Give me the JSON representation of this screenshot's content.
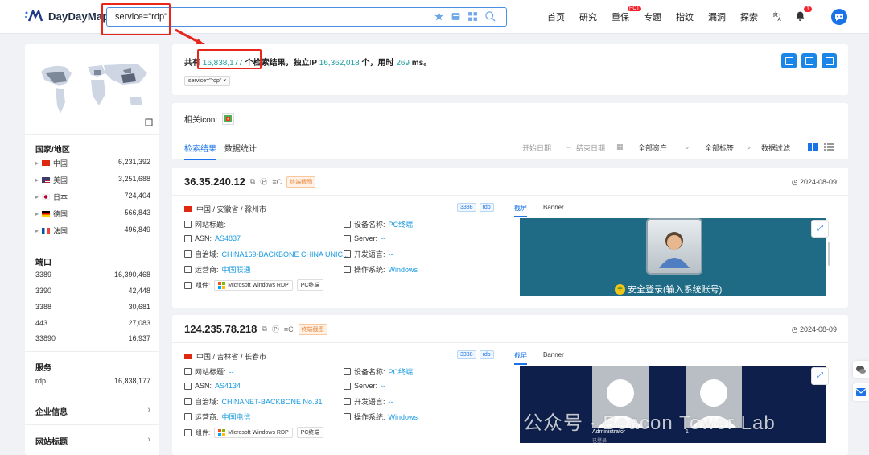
{
  "app": {
    "name": "DayDayMap"
  },
  "search": {
    "query": "service=\"rdp\""
  },
  "nav": [
    {
      "label": "首页"
    },
    {
      "label": "研究"
    },
    {
      "label": "重保",
      "badge": "HOT"
    },
    {
      "label": "专题"
    },
    {
      "label": "指纹"
    },
    {
      "label": "漏洞"
    },
    {
      "label": "探索"
    },
    {
      "label": "···"
    }
  ],
  "notifications": {
    "count": "1"
  },
  "summary": {
    "prefix": "共有",
    "total": "16,838,177",
    "mid1": "个检索结果，独立IP",
    "unique_ip": "16,362,018",
    "mid2": "个，用时",
    "time": "269",
    "suffix": "ms。",
    "chip": "service=\"rdp\""
  },
  "country": {
    "title": "国家/地区",
    "items": [
      {
        "flag": "cn",
        "name": "中国",
        "count": "6,231,392"
      },
      {
        "flag": "us",
        "name": "美国",
        "count": "3,251,688"
      },
      {
        "flag": "jp",
        "name": "日本",
        "count": "724,404"
      },
      {
        "flag": "de",
        "name": "德国",
        "count": "566,843"
      },
      {
        "flag": "fr",
        "name": "法国",
        "count": "496,849"
      }
    ]
  },
  "ports": {
    "title": "端口",
    "items": [
      {
        "port": "3389",
        "count": "16,390,468"
      },
      {
        "port": "3390",
        "count": "42,448"
      },
      {
        "port": "3388",
        "count": "30,681"
      },
      {
        "port": "443",
        "count": "27,083"
      },
      {
        "port": "33890",
        "count": "16,937"
      }
    ]
  },
  "services": {
    "title": "服务",
    "items": [
      {
        "name": "rdp",
        "count": "16,838,177"
      }
    ]
  },
  "menus": {
    "company": "企业信息",
    "site_title": "网站标题"
  },
  "filters": {
    "icon_label": "相关icon:",
    "tab_results": "检索结果",
    "tab_stats": "数据统计",
    "start_date": "开始日期",
    "arrow": "→",
    "end_date": "结束日期",
    "assets": "全部资产",
    "tags": "全部标签",
    "data_filter": "数据过滤"
  },
  "results": [
    {
      "ip": "36.35.240.12",
      "tag": "终端截图",
      "date": "2024-08-09",
      "location": "中国 / 安徽省 / 滁州市",
      "port": "3388",
      "proto": "rdp",
      "site_title_label": "网站标题:",
      "site_title": "--",
      "device_label": "设备名称:",
      "device": "PC终端",
      "asn_label": "ASN:",
      "asn": "AS4837",
      "server_label": "Server:",
      "server": "--",
      "as_label": "自治域:",
      "as": "CHINA169-BACKBONE CHINA UNIC...",
      "lang_label": "开发语言:",
      "lang": "--",
      "isp_label": "运营商:",
      "isp": "中国联通",
      "os_label": "操作系统:",
      "os": "Windows",
      "comp_label": "组件:",
      "comp1": "Microsoft Windows RDP",
      "comp2": "PC终端",
      "shot_tab": "截屏",
      "banner_tab": "Banner",
      "shot_text": "安全登录(输入系统账号)"
    },
    {
      "ip": "124.235.78.218",
      "tag": "终端截图",
      "date": "2024-08-09",
      "location": "中国 / 吉林省 / 长春市",
      "port": "3388",
      "proto": "rdp",
      "site_title_label": "网站标题:",
      "site_title": "--",
      "device_label": "设备名称:",
      "device": "PC终端",
      "asn_label": "ASN:",
      "asn": "AS4134",
      "server_label": "Server:",
      "server": "--",
      "as_label": "自治域:",
      "as": "CHINANET-BACKBONE No.31",
      "lang_label": "开发语言:",
      "lang": "--",
      "isp_label": "运营商:",
      "isp": "中国电信",
      "os_label": "操作系统:",
      "os": "Windows",
      "comp_label": "组件:",
      "comp1": "Microsoft Windows RDP",
      "comp2": "PC终端",
      "shot_tab": "截屏",
      "banner_tab": "Banner",
      "shot_user1": "Administrator",
      "shot_user1_sub": "已登录",
      "shot_user2": "1"
    }
  ],
  "watermark": "公众号 · Beacon Tower Lab",
  "colors": {
    "accent": "#1a73e8",
    "highlight": "#e8261c",
    "teal": "#1a9e9e"
  }
}
